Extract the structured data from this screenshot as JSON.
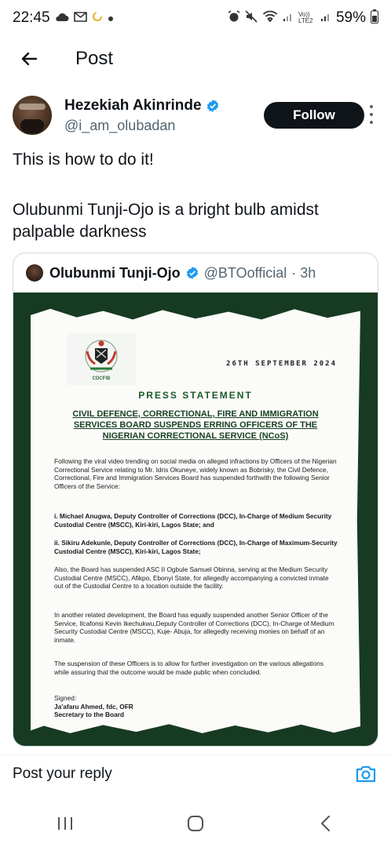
{
  "status_bar": {
    "time": "22:45",
    "battery": "59%",
    "network_label": "Vo)) LTE2"
  },
  "header": {
    "title": "Post"
  },
  "author": {
    "name": "Hezekiah Akinrinde",
    "handle": "@i_am_olubadan",
    "follow_label": "Follow"
  },
  "post": {
    "line1": "This is how to do it!",
    "line2": "Olubunmi Tunji-Ojo is a bright bulb amidst palpable darkness"
  },
  "quote": {
    "name": "Olubunmi Tunji-Ojo",
    "handle": "@BTOofficial",
    "time": "· 3h",
    "document": {
      "crest_label": "CDCFIB",
      "date": "26TH SEPTEMBER 2024",
      "title": "PRESS STATEMENT",
      "headline": "CIVIL DEFENCE, CORRECTIONAL, FIRE AND IMMIGRATION SERVICES BOARD SUSPENDS ERRING OFFICERS OF THE NIGERIAN CORRECTIONAL SERVICE (NCoS)",
      "para1": "Following the viral video trending on social media on alleged infractions by Officers of the Nigerian Correctional Service relating to Mr. Idris Okuneye, widely known as Bobrisky, the Civil Defence, Correctional, Fire and Immigration Services Board has suspended forthwith the following Senior Officers of the Service:",
      "item1": "i.  Michael Anugwa, Deputy Controller of Corrections (DCC), In-Charge of Medium Security Custodial Centre (MSCC), Kiri-kiri, Lagos State; and",
      "item2": "ii.  Sikiru Adekunle, Deputy Controller of Corrections (DCC), In-Charge of Maximum-Security Custodial Centre (MSCC), Kiri-kiri, Lagos State;",
      "para2": "Also, the Board has suspended ASC II Ogbule Samuel Obinna, serving at the Medium Security Custodial Centre (MSCC), Afikpo, Ebonyi State, for allegedly accompanying a convicted inmate out of the Custodial Centre to a location outside the facility.",
      "para3": "In another related development, the Board has equally suspended another Senior Officer of the Service, Ilcafonsi Kevin Ikechukwu,Deputy Controller of Corrections (DCC), In-Charge of Medium Security Custodial Centre (MSCC), Kuje- Abuja, for allegedly receiving monies on behalf of an inmate.",
      "para4": "The suspension of these Officers is to allow for further investigation on the various allegations while assuring that the outcome would be made public when concluded.",
      "signed": "Signed:",
      "signer": "Ja'afaru Ahmed, fdc, OFR",
      "signer_title": "Secretary to the Board"
    }
  },
  "reply": {
    "placeholder": "Post your reply"
  },
  "colors": {
    "follow_bg": "#0f1419",
    "verified": "#1d9bf0",
    "camera": "#1d9bf0",
    "doc_border_green": "#173b22"
  }
}
